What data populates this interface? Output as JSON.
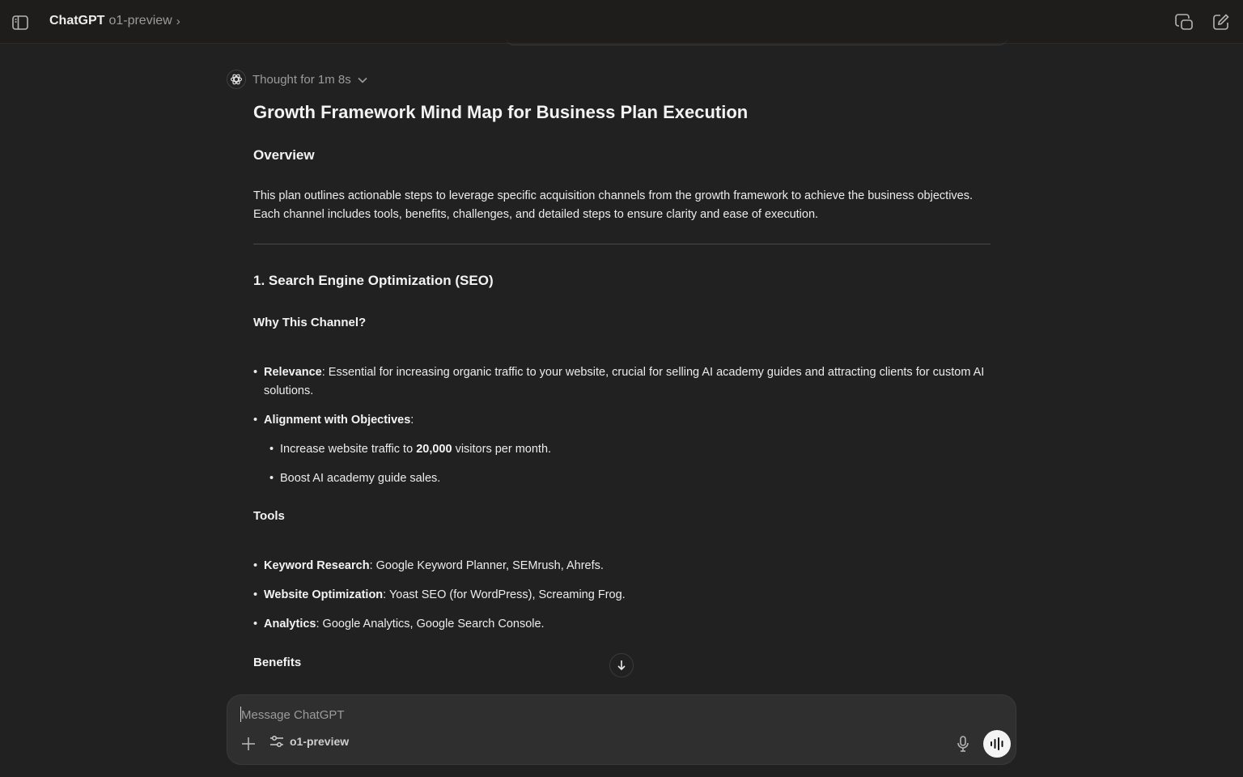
{
  "header": {
    "app_name": "ChatGPT",
    "model_name": "o1-preview",
    "chevron": "›",
    "icons": [
      "sidebar-toggle-icon",
      "temporary-chat-icon",
      "new-chat-icon"
    ]
  },
  "thought": {
    "label": "Thought for 1m 8s"
  },
  "message": {
    "title": "Growth Framework Mind Map for Business Plan Execution",
    "overview_heading": "Overview",
    "overview_text": "This plan outlines actionable steps to leverage specific acquisition channels from the growth framework to achieve the business objectives. Each channel includes tools, benefits, challenges, and detailed steps to ensure clarity and ease of execution.",
    "seo_heading": "1. Search Engine Optimization (SEO)",
    "why_heading": "Why This Channel?",
    "why_items": [
      {
        "bold": "Relevance",
        "text": ": Essential for increasing organic traffic to your website, crucial for selling AI academy guides and attracting clients for custom AI solutions."
      },
      {
        "bold": "Alignment with Objectives",
        "text": ":"
      }
    ],
    "alignment_subitems": [
      {
        "before": "Increase website traffic to ",
        "bold": "20,000",
        "after": " visitors per month."
      },
      {
        "text": "Boost AI academy guide sales."
      }
    ],
    "tools_heading": "Tools",
    "tools_items": [
      {
        "bold": "Keyword Research",
        "text": ": Google Keyword Planner, SEMrush, Ahrefs."
      },
      {
        "bold": "Website Optimization",
        "text": ": Yoast SEO (for WordPress), Screaming Frog."
      },
      {
        "bold": "Analytics",
        "text": ": Google Analytics, Google Search Console."
      }
    ],
    "benefits_heading": "Benefits"
  },
  "composer": {
    "placeholder": "Message ChatGPT",
    "value": "",
    "model_label": "o1-preview"
  },
  "bullet": "•",
  "colors": {
    "background": "#212121",
    "topbar": "#1f1d1c",
    "composer": "#2f2f2f",
    "text": "#ececec",
    "muted": "#9b9b9b"
  }
}
